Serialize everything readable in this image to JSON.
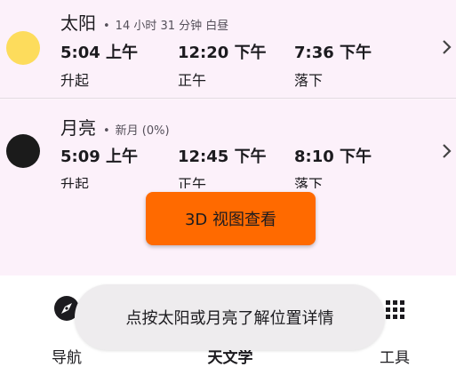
{
  "sun": {
    "title": "太阳",
    "subtitle": "14 小时 31 分钟 白昼",
    "rise_time": "5:04 上午",
    "rise_label": "升起",
    "noon_time": "12:20 下午",
    "noon_label": "正午",
    "set_time": "7:36 下午",
    "set_label": "落下",
    "color": "#fddc5c"
  },
  "moon": {
    "title": "月亮",
    "subtitle": "新月 (0%)",
    "rise_time": "5:09 上午",
    "rise_label": "升起",
    "transit_time": "12:45 下午",
    "transit_label": "正午",
    "set_time": "8:10 下午",
    "set_label": "落下",
    "color": "#1b1b1b"
  },
  "view3d_button": {
    "label": "3D 视图查看",
    "color": "#ff6a00"
  },
  "bottom_nav": {
    "items": [
      {
        "label": "导航",
        "icon": "compass-icon"
      },
      {
        "label": "天文学",
        "icon": "sun-icon",
        "active": true
      },
      {
        "label": "工具",
        "icon": "grid-icon"
      }
    ]
  },
  "toast": {
    "message": "点按太阳或月亮了解位置详情"
  }
}
